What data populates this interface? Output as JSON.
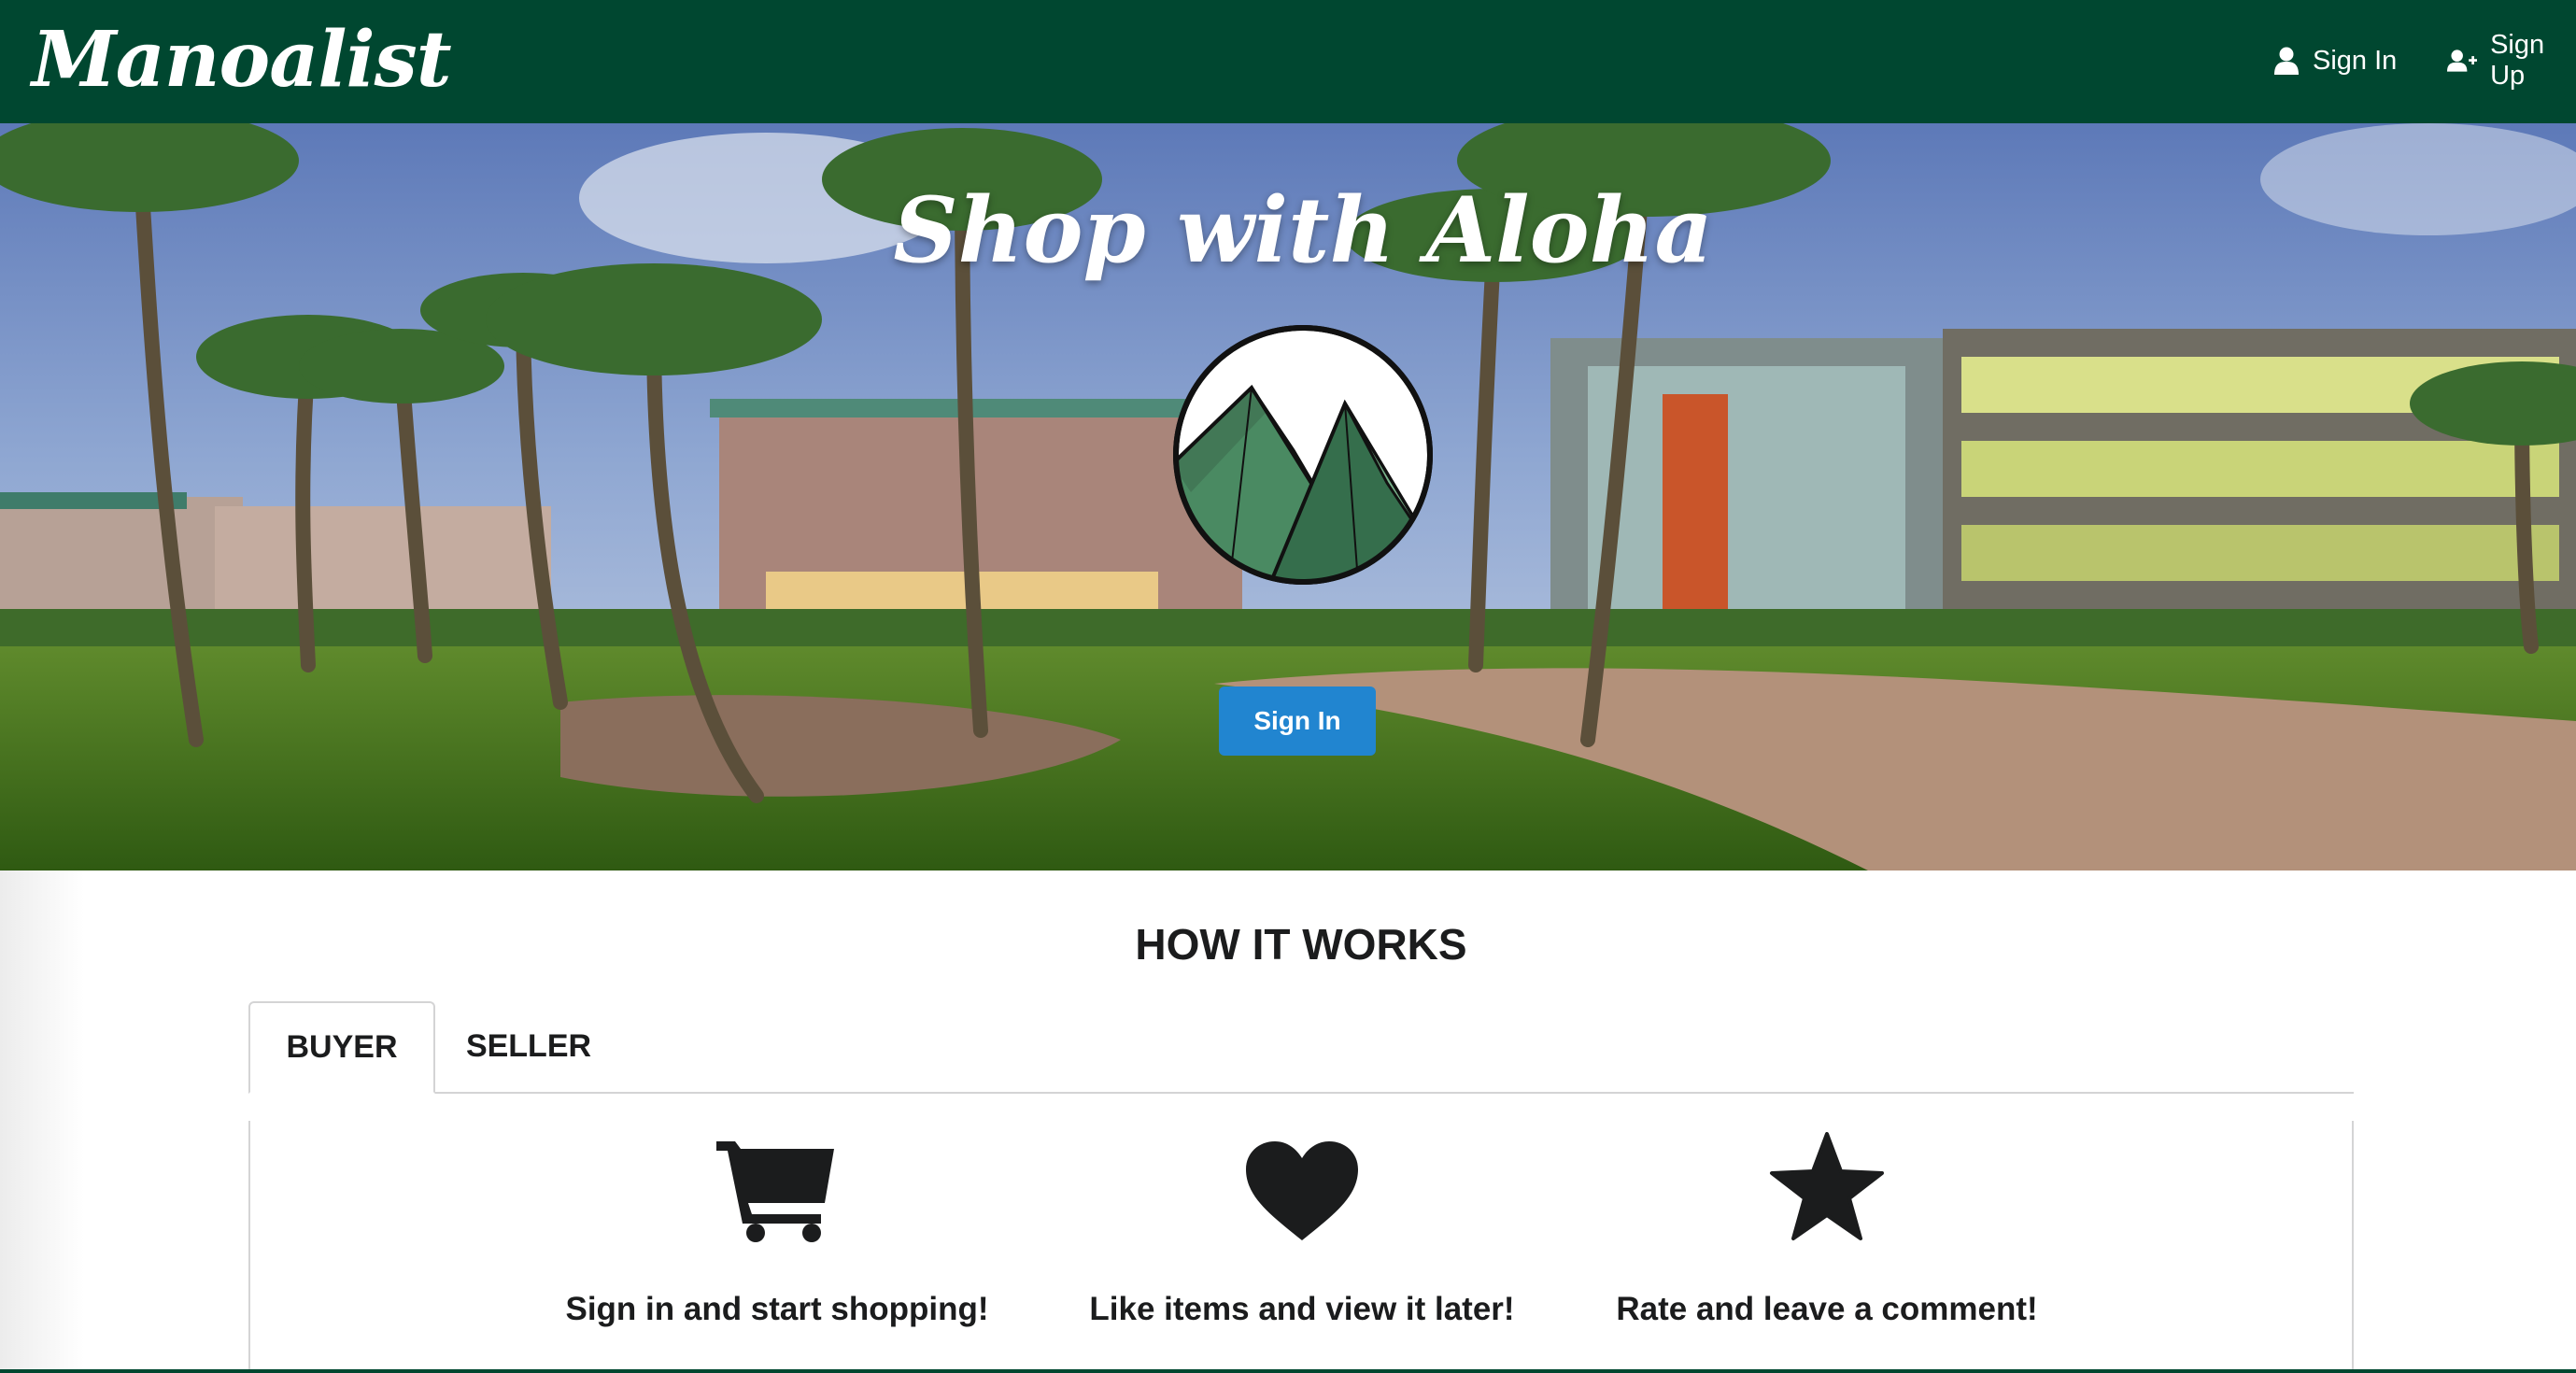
{
  "navbar": {
    "brand": "Manoalist",
    "sign_in_label": "Sign In",
    "sign_up_label": "Sign Up",
    "background_color": "#004730"
  },
  "hero": {
    "title": "Shop with Aloha",
    "button_label": "Sign In",
    "button_color": "#2185d0",
    "logo_icon": "mountain-logo-icon"
  },
  "how_it_works": {
    "title": "HOW IT WORKS",
    "tabs": [
      {
        "label": "BUYER",
        "active": true
      },
      {
        "label": "SELLER",
        "active": false
      }
    ],
    "features": [
      {
        "icon": "shopping-cart-icon",
        "caption": "Sign in and start shopping!"
      },
      {
        "icon": "heart-icon",
        "caption": "Like items and view it later!"
      },
      {
        "icon": "star-icon",
        "caption": "Rate and leave a comment!"
      }
    ]
  }
}
